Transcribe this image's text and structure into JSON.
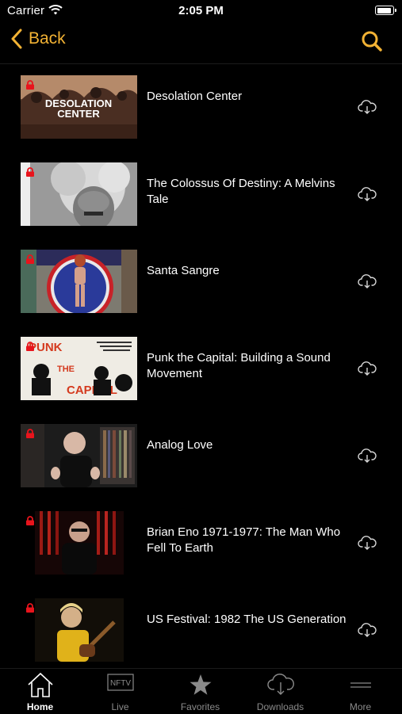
{
  "status_bar": {
    "carrier": "Carrier",
    "time": "2:05 PM",
    "battery_level": 0.95
  },
  "nav": {
    "back_label": "Back",
    "accent_color": "#f2b234"
  },
  "items": [
    {
      "title": "Desolation Center",
      "thumb_text": "DESOLATION CENTER",
      "locked": true
    },
    {
      "title": "The Colossus Of Destiny: A Melvins Tale",
      "locked": true
    },
    {
      "title": "Santa Sangre",
      "locked": true
    },
    {
      "title": "Punk the Capital: Building a Sound Movement",
      "thumb_text": "PUNK THE CAPITAL",
      "locked": true
    },
    {
      "title": "Analog Love",
      "locked": true
    },
    {
      "title": "Brian Eno 1971-1977: The Man Who Fell To Earth",
      "locked": true
    },
    {
      "title": "US Festival: 1982 The US Generation",
      "locked": true
    }
  ],
  "lock_color": "#e8141c",
  "tabs": [
    {
      "label": "Home",
      "icon": "house-icon",
      "active": true
    },
    {
      "label": "Live",
      "icon": "nftv-icon",
      "icon_text": "NFTV",
      "active": false
    },
    {
      "label": "Favorites",
      "icon": "star-icon",
      "active": false
    },
    {
      "label": "Downloads",
      "icon": "cloud-download-icon",
      "active": false
    },
    {
      "label": "More",
      "icon": "menu-lines-icon",
      "active": false
    }
  ]
}
